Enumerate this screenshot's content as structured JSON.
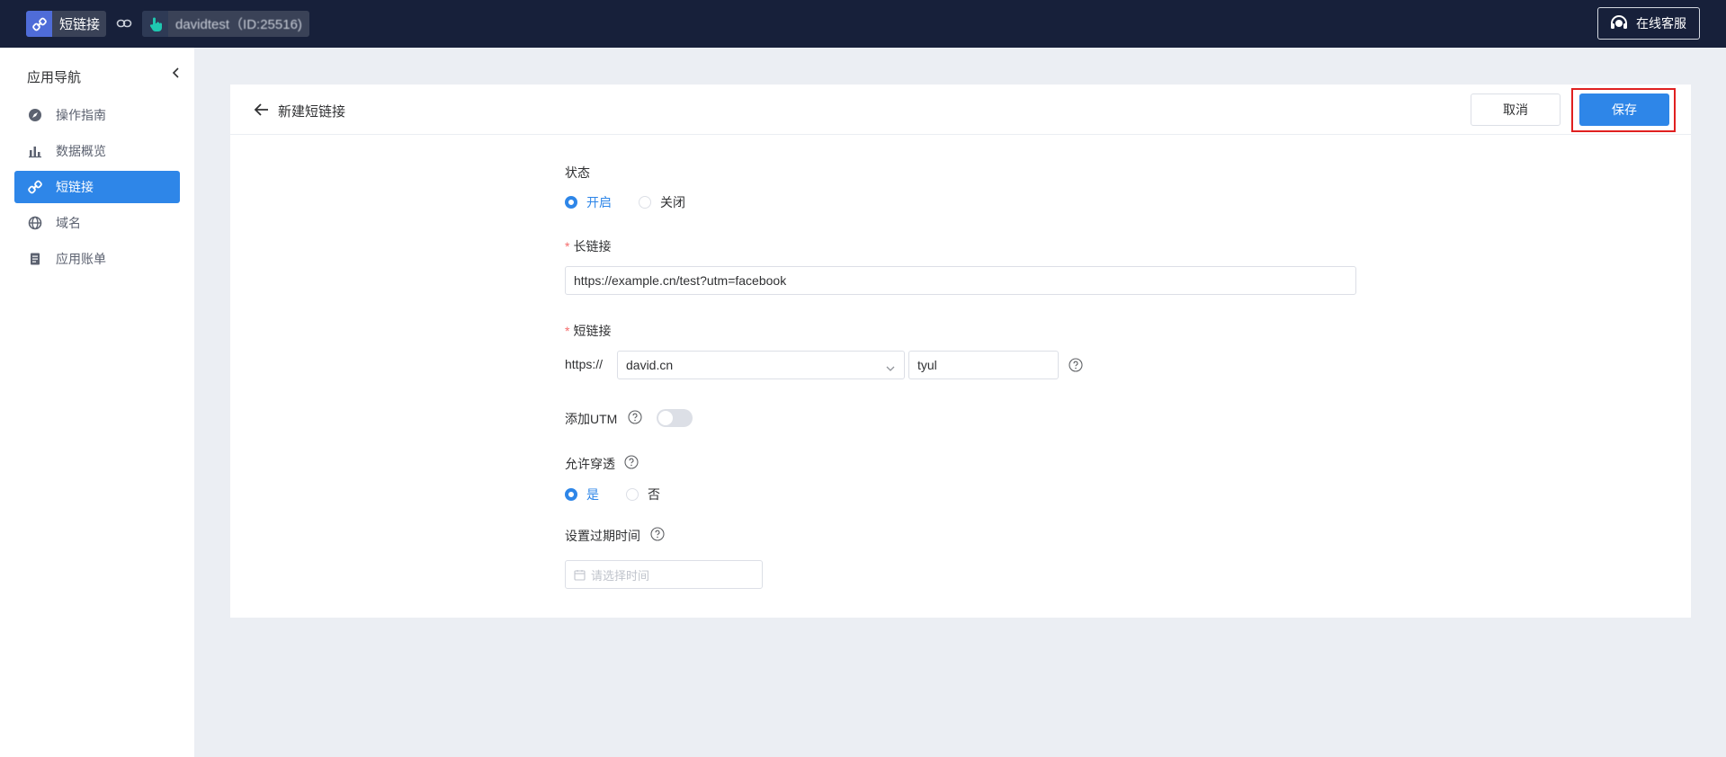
{
  "topbar": {
    "app_label": "短链接",
    "user_label": "davidtest（ID:25516)",
    "support_label": "在线客服"
  },
  "sidebar": {
    "title": "应用导航",
    "items": [
      {
        "label": "操作指南",
        "icon": "compass-icon"
      },
      {
        "label": "数据概览",
        "icon": "bar-chart-icon"
      },
      {
        "label": "短链接",
        "icon": "link-icon"
      },
      {
        "label": "域名",
        "icon": "globe-icon"
      },
      {
        "label": "应用账单",
        "icon": "document-icon"
      }
    ],
    "active_index": 2
  },
  "header": {
    "title": "新建短链接",
    "cancel_label": "取消",
    "save_label": "保存"
  },
  "form": {
    "status": {
      "label": "状态",
      "options": [
        "开启",
        "关闭"
      ],
      "selected": "开启"
    },
    "long_link": {
      "label": "长链接",
      "required": true,
      "value": "https://example.cn/test?utm=facebook"
    },
    "short_link": {
      "label": "短链接",
      "required": true,
      "prefix": "https://",
      "domain": "david.cn",
      "path": "tyul"
    },
    "utm": {
      "label": "添加UTM",
      "enabled": false
    },
    "passthrough": {
      "label": "允许穿透",
      "options": [
        "是",
        "否"
      ],
      "selected": "是"
    },
    "expire": {
      "label": "设置过期时间",
      "placeholder": "请选择时间"
    }
  },
  "colors": {
    "primary": "#2e86e8",
    "topbar": "#17203a",
    "required": "#f56c6c",
    "highlight": "#e02020"
  }
}
